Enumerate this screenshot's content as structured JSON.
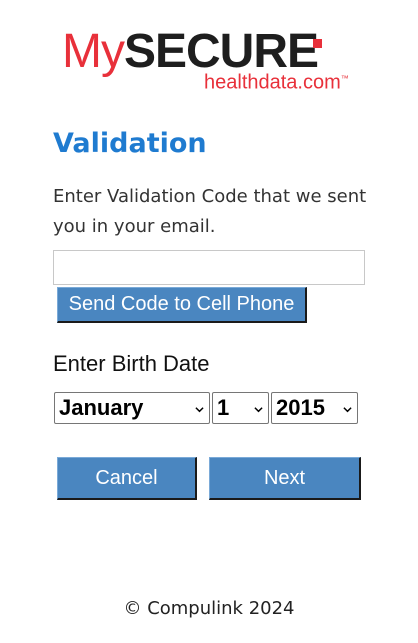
{
  "logo": {
    "my": "My",
    "secure": "SECURE",
    "sub": "healthdata.com",
    "tm": "™"
  },
  "page_title": "Validation",
  "instruction": "Enter Validation Code that we sent you in your email.",
  "code_input": {
    "value": "",
    "placeholder": ""
  },
  "send_code_label": "Send Code to Cell Phone",
  "birth_label": "Enter Birth Date",
  "birth_date": {
    "month": "January",
    "day": "1",
    "year": "2015"
  },
  "cancel_label": "Cancel",
  "next_label": "Next",
  "footer": "© Compulink 2024",
  "colors": {
    "title_blue": "#1f7bd0",
    "button_blue": "#4a86c0",
    "logo_red": "#e8303a"
  },
  "icons": {
    "select_arrow": "chevron-down-icon"
  }
}
